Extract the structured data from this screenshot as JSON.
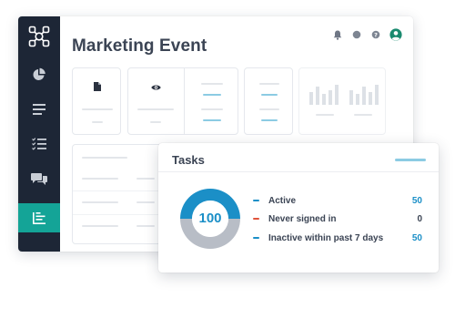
{
  "app": {
    "title": "Marketing Event",
    "colors": {
      "sidebar": "#1d2636",
      "accent": "#14a497",
      "teal": "#8ccbe3",
      "blue": "#1b8fc7"
    }
  },
  "sidebar": {
    "logo_icon": "network-logo-icon",
    "items": [
      {
        "icon": "pie-chart-icon",
        "active": false
      },
      {
        "icon": "list-icon",
        "active": false
      },
      {
        "icon": "checklist-icon",
        "active": false
      },
      {
        "icon": "chat-bubbles-icon",
        "active": false
      },
      {
        "icon": "bar-chart-icon",
        "active": true
      }
    ]
  },
  "header": {
    "icons": [
      "bell-icon",
      "circle-icon",
      "help-icon",
      "user-avatar-icon"
    ]
  },
  "cards": {
    "card1_icon": "document-icon",
    "card2_icon": "eye-icon"
  },
  "tasks": {
    "title": "Tasks",
    "total": "100",
    "rows": [
      {
        "label": "Active",
        "value": "50",
        "color": "#1b8fc7"
      },
      {
        "label": "Never signed in",
        "value": "0",
        "color": "#e0533b"
      },
      {
        "label": "Inactive within past 7 days",
        "value": "50",
        "color": "#1b8fc7"
      }
    ]
  },
  "chart_data": {
    "type": "pie",
    "title": "Tasks",
    "total": 100,
    "categories": [
      "Active",
      "Never signed in",
      "Inactive within past 7 days"
    ],
    "values": [
      50,
      0,
      50
    ],
    "colors": [
      "#1b8fc7",
      "#e0533b",
      "#b8bdc6"
    ]
  }
}
